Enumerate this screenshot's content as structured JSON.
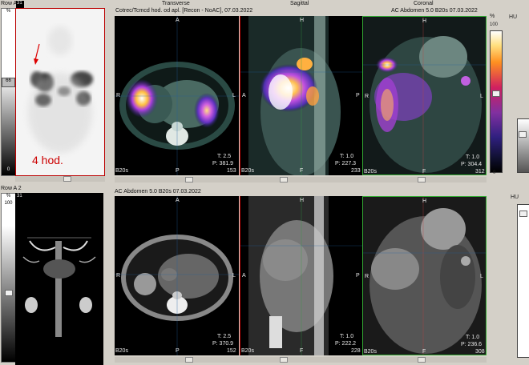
{
  "row_a1": {
    "label": "Row A 1",
    "header": "Cotrec/Tcmcd hod. od apl. [Recon - NoAC], 07.03.2022",
    "views": [
      "Transverse",
      "Sagittal",
      "Coronal"
    ],
    "right_header": "AC  Abdomen  5.0  B20s  07.03.2022",
    "mip_number": "31",
    "mip_annotation": "4 hod.",
    "scale_top_left": "%",
    "scale_top_right": "%",
    "scale_value": "100",
    "scale_val_left": "66",
    "scale_val_bottom": "0",
    "scale_val_bottom_right": "0",
    "t_values": [
      "T: 2.5",
      "T: 1.0",
      "T: 1.0"
    ],
    "p_values": [
      "P: 381.9",
      "P: 227.3",
      "P: 304.4"
    ],
    "series": [
      "B20s",
      "B20s",
      "B20s"
    ],
    "frame_numbers": [
      "153",
      "233",
      "312"
    ],
    "orient_top": [
      "A",
      "H",
      "H"
    ],
    "orient_left": [
      "R",
      "A",
      "R"
    ],
    "orient_right": [
      "L",
      "P",
      "L"
    ],
    "orient_bottom": [
      "P",
      "F",
      "F"
    ],
    "right_scale_value": "100",
    "right_scale_label": "HU"
  },
  "row_a2": {
    "label": "Row A 2",
    "header": "AC  Abdomen  5.0  B20s  07.03.2022",
    "mip_number": "31",
    "scale_top_left": "%",
    "scale_value": "100",
    "scale_val_bottom": "0",
    "t_values": [
      "T: 2.5",
      "T: 1.0",
      "T: 1.0"
    ],
    "p_values": [
      "P: 370.9",
      "P: 222.2",
      "P: 236.6"
    ],
    "series": [
      "B20s",
      "B20s",
      "B20s"
    ],
    "frame_numbers": [
      "152",
      "228",
      "308"
    ],
    "orient_top": [
      "A",
      "H",
      "H"
    ],
    "orient_left": [
      "R",
      "A",
      "R"
    ],
    "orient_right": [
      "L",
      "P",
      "L"
    ],
    "orient_bottom": [
      "P",
      "F",
      "F"
    ],
    "right_scale_label": "HU"
  }
}
